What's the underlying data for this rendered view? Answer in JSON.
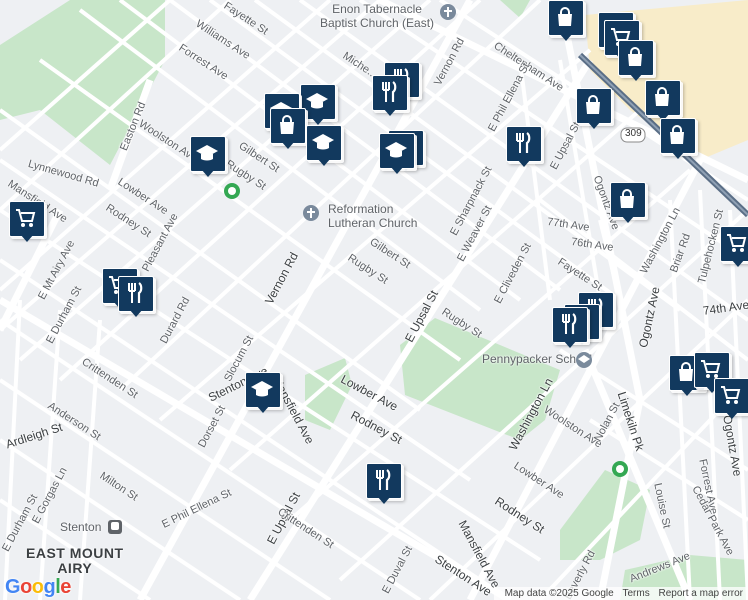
{
  "map": {
    "attribution": {
      "data": "Map data ©2025 Google",
      "terms": "Terms",
      "report": "Report a map error"
    },
    "logo": "Google",
    "colors": {
      "park": "#c8e6c9",
      "road": "#ffffff",
      "highway": "#12395e",
      "marker": "#12395e",
      "mall": "#f8ecc9"
    },
    "streets": {
      "fayette_st_top": "Fayette St",
      "williams_ave": "Williams Ave",
      "forrest_ave_top": "Forrest Ave",
      "woolston_ave_top": "Woolston Ave",
      "easton_rd": "Easton Rd",
      "lynnewood_rd": "Lynnewood Rd",
      "mansfield_ave_left": "Mansfield Ave",
      "lowber_ave_left": "Lowber Ave",
      "rodney_st_left": "Rodney St",
      "pleasant_ave": "Pleasant Ave",
      "e_mt_airy_ave": "E Mt Airy Ave",
      "gilbert_st_top": "Gilbert St",
      "rugby_st_top": "Rugby St",
      "michener_ave": "Miche...",
      "vernon_rd_top": "Vernon Rd",
      "vernon_rd": "Vernon Rd",
      "cheltenham_ave": "Cheltenham Ave",
      "e_phil_ellena_st_top": "E Phil Ellena St",
      "e_upsal_st_top": "E Upsal St",
      "e_sharpnack_st": "E Sharpnack St",
      "e_weaver_st": "E Weaver St",
      "gilbert_st": "Gilbert St",
      "rugby_st": "Rugby St",
      "e_upsal_st": "E Upsal St",
      "rugby_st_right": "Rugby St",
      "ogontz_ave_top": "Ogontz Ave",
      "77th_ave": "77th Ave",
      "76th_ave": "76th Ave",
      "fayette_st_right": "Fayette St",
      "e_cliveden_st": "E Cliveden St",
      "washington_ln_top": "Washington Ln",
      "briar_rd": "Briar Rd",
      "tulpehocken_st": "Tulpehocken St",
      "74th_ave": "74th Ave",
      "ogontz_ave": "Ogontz Ave",
      "durard_rd": "Durard Rd",
      "e_durham_st": "E Durham St",
      "crittenden_st_left": "Crittenden St",
      "slocum_st": "Slocum St",
      "mansfield_ave": "Mansfield Ave",
      "lowber_ave": "Lowber Ave",
      "rodney_st": "Rodney St",
      "washington_ln": "Washington Ln",
      "woolston_ave": "Woolston Ave",
      "nolan_st": "Nolan St",
      "limekiln_pk": "Limekiln Pk",
      "lowber_ave_right": "Lowber Ave",
      "anderson_st": "Anderson St",
      "stenton_ave": "Stenton Ave",
      "dorset_st": "Dorset St",
      "ardleigh_st": "Ardleigh St",
      "milton_st": "Milton St",
      "e_phil_ellena_st": "E Phil Ellena St",
      "e_upsal_st_bottom": "E Upsal St",
      "crittenden_st": "Crittenden St",
      "e_gorgas_ln": "E Gorgas Ln",
      "e_durham_st_bottom": "E Durham St",
      "rodney_st_right": "Rodney St",
      "mansfield_ave_bottom": "Mansfield Ave",
      "stenton_ave_bottom": "Stenton Ave",
      "e_duval_st": "E Duval St",
      "beverly_rd": "Beverly Rd",
      "louise_st": "Louise St",
      "forrest_ave": "Forrest Ave",
      "cedar_park_ave": "Cedar Park Ave",
      "andrews_ave": "Andrews Ave",
      "ogontz_ave_right": "Ogontz Ave",
      "route_309": "309"
    },
    "places": {
      "church_top": "Enon Tabernacle\nBaptist Church (East)",
      "church_mid": "Reformation\nLutheran Church",
      "school": "Pennypacker School",
      "stenton": "Stenton",
      "neighborhood": "EAST MOUNT\nAIRY"
    }
  }
}
